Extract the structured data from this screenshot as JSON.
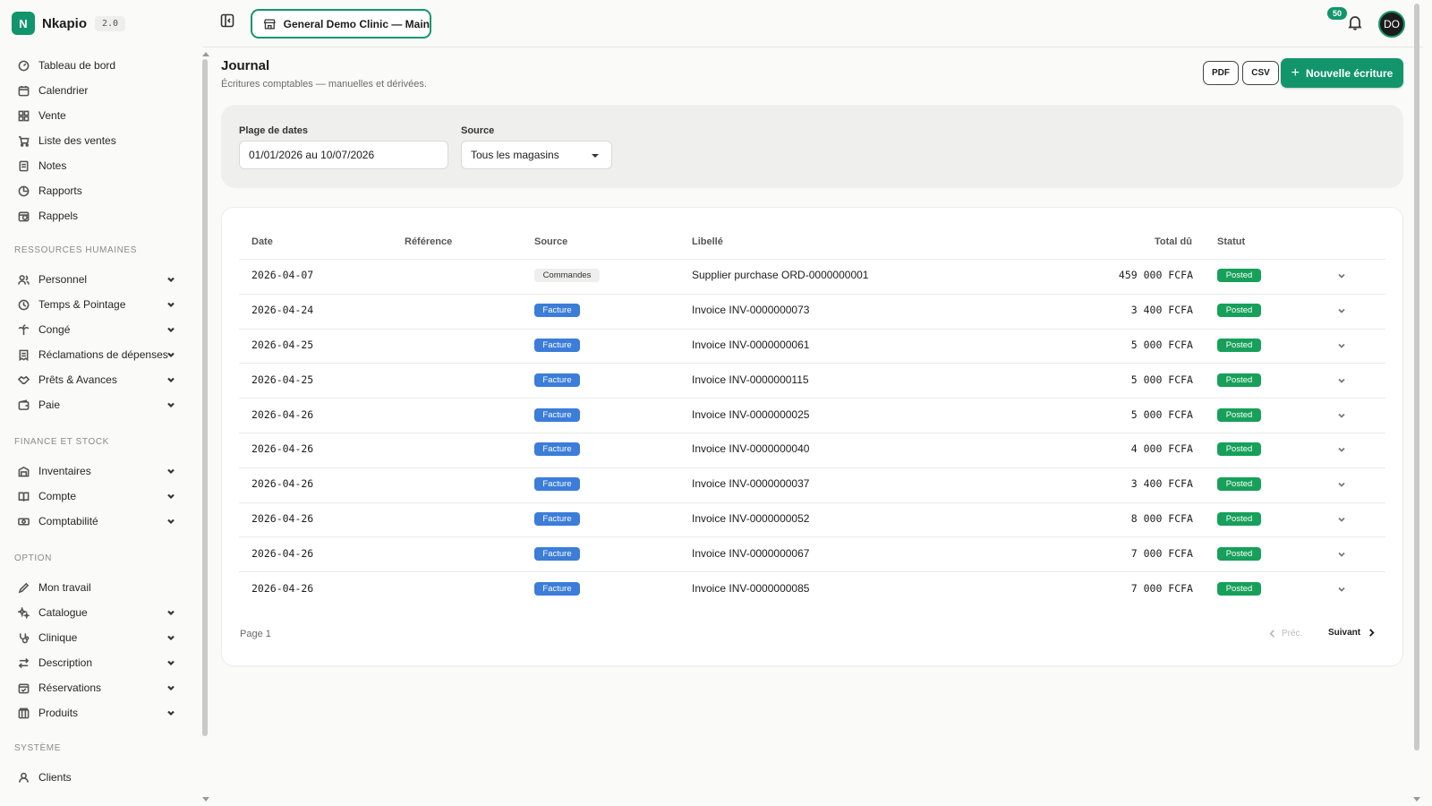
{
  "brand": {
    "name": "Nkapio",
    "version": "2.0"
  },
  "sidebar": {
    "top_items": [
      {
        "label": "Tableau de bord",
        "icon": "gauge-icon"
      },
      {
        "label": "Calendrier",
        "icon": "calendar-icon"
      },
      {
        "label": "Vente",
        "icon": "grid-icon"
      },
      {
        "label": "Liste des ventes",
        "icon": "cart-icon"
      },
      {
        "label": "Notes",
        "icon": "note-icon"
      },
      {
        "label": "Rapports",
        "icon": "pie-chart-icon"
      },
      {
        "label": "Rappels",
        "icon": "calendar-clock-icon"
      }
    ],
    "sections": [
      {
        "title": "RESSOURCES HUMAINES",
        "items": [
          {
            "label": "Personnel",
            "icon": "users-icon"
          },
          {
            "label": "Temps & Pointage",
            "icon": "clock-icon"
          },
          {
            "label": "Congé",
            "icon": "palm-icon"
          },
          {
            "label": "Réclamations de dépenses",
            "icon": "receipt-icon"
          },
          {
            "label": "Prêts & Avances",
            "icon": "handshake-icon"
          },
          {
            "label": "Paie",
            "icon": "wallet-icon"
          }
        ]
      },
      {
        "title": "FINANCE ET STOCK",
        "items": [
          {
            "label": "Inventaires",
            "icon": "warehouse-icon"
          },
          {
            "label": "Compte",
            "icon": "book-icon"
          },
          {
            "label": "Comptabilité",
            "icon": "money-icon"
          }
        ]
      },
      {
        "title": "OPTION",
        "items": [
          {
            "label": "Mon travail",
            "icon": "pen-icon"
          },
          {
            "label": "Catalogue",
            "icon": "sparkles-icon"
          },
          {
            "label": "Clinique",
            "icon": "stethoscope-icon"
          },
          {
            "label": "Description",
            "icon": "swap-icon"
          },
          {
            "label": "Réservations",
            "icon": "calendar-check-icon"
          },
          {
            "label": "Produits",
            "icon": "box-icon"
          }
        ]
      },
      {
        "title": "SYSTÈME",
        "items": [
          {
            "label": "Clients",
            "icon": "user-icon"
          }
        ]
      }
    ]
  },
  "topbar": {
    "clinic": "General Demo Clinic — Main",
    "notifications": "50",
    "avatar": "DO"
  },
  "header": {
    "title": "Journal",
    "subtitle": "Écritures comptables — manuelles et dérivées.",
    "pdf": "PDF",
    "csv": "CSV",
    "new_entry": "Nouvelle écriture"
  },
  "filters": {
    "date_label": "Plage de dates",
    "date_value": "01/01/2026 au 10/07/2026",
    "source_label": "Source",
    "source_value": "Tous les magasins"
  },
  "table": {
    "columns": {
      "date": "Date",
      "reference": "Référence",
      "source": "Source",
      "label": "Libellé",
      "total": "Total dû",
      "status": "Statut"
    },
    "rows": [
      {
        "date": "2026-04-07",
        "reference": "",
        "source": "Commandes",
        "label": "Supplier purchase ORD-0000000001",
        "total": "459 000 FCFA",
        "status": "Posted"
      },
      {
        "date": "2026-04-24",
        "reference": "",
        "source": "Facture",
        "label": "Invoice INV-0000000073",
        "total": "3 400 FCFA",
        "status": "Posted"
      },
      {
        "date": "2026-04-25",
        "reference": "",
        "source": "Facture",
        "label": "Invoice INV-0000000061",
        "total": "5 000 FCFA",
        "status": "Posted"
      },
      {
        "date": "2026-04-25",
        "reference": "",
        "source": "Facture",
        "label": "Invoice INV-0000000115",
        "total": "5 000 FCFA",
        "status": "Posted"
      },
      {
        "date": "2026-04-26",
        "reference": "",
        "source": "Facture",
        "label": "Invoice INV-0000000025",
        "total": "5 000 FCFA",
        "status": "Posted"
      },
      {
        "date": "2026-04-26",
        "reference": "",
        "source": "Facture",
        "label": "Invoice INV-0000000040",
        "total": "4 000 FCFA",
        "status": "Posted"
      },
      {
        "date": "2026-04-26",
        "reference": "",
        "source": "Facture",
        "label": "Invoice INV-0000000037",
        "total": "3 400 FCFA",
        "status": "Posted"
      },
      {
        "date": "2026-04-26",
        "reference": "",
        "source": "Facture",
        "label": "Invoice INV-0000000052",
        "total": "8 000 FCFA",
        "status": "Posted"
      },
      {
        "date": "2026-04-26",
        "reference": "",
        "source": "Facture",
        "label": "Invoice INV-0000000067",
        "total": "7 000 FCFA",
        "status": "Posted"
      },
      {
        "date": "2026-04-26",
        "reference": "",
        "source": "Facture",
        "label": "Invoice INV-0000000085",
        "total": "7 000 FCFA",
        "status": "Posted"
      }
    ]
  },
  "pagination": {
    "page": "Page 1",
    "prev": "Préc.",
    "next": "Suivant"
  },
  "colors": {
    "accent": "#12956b",
    "facture": "#3b7dd8",
    "posted": "#17a05a"
  }
}
